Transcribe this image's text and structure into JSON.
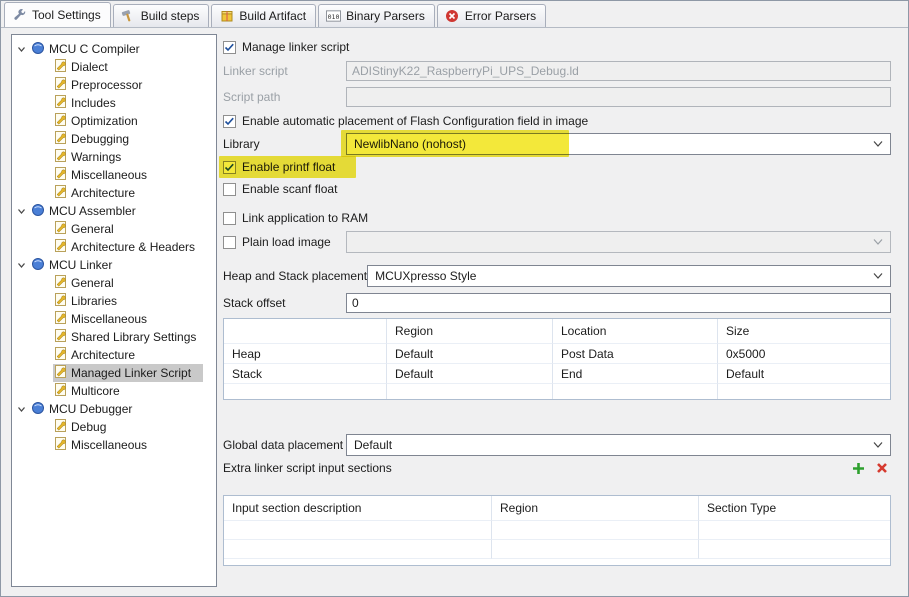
{
  "colors": {
    "highlight": "#f3e83a",
    "selection": "#c9c9c9"
  },
  "tabs": [
    {
      "label": "Tool Settings",
      "icon": "wrench-icon",
      "active": true
    },
    {
      "label": "Build steps",
      "icon": "hammer-icon",
      "active": false
    },
    {
      "label": "Build Artifact",
      "icon": "package-icon",
      "active": false
    },
    {
      "label": "Binary Parsers",
      "icon": "binary-icon",
      "icon_glyph": "010",
      "active": false
    },
    {
      "label": "Error Parsers",
      "icon": "error-icon",
      "active": false
    }
  ],
  "tree": {
    "groups": [
      {
        "label": "MCU C Compiler",
        "children": [
          "Dialect",
          "Preprocessor",
          "Includes",
          "Optimization",
          "Debugging",
          "Warnings",
          "Miscellaneous",
          "Architecture"
        ]
      },
      {
        "label": "MCU Assembler",
        "children": [
          "General",
          "Architecture & Headers"
        ]
      },
      {
        "label": "MCU Linker",
        "children": [
          "General",
          "Libraries",
          "Miscellaneous",
          "Shared Library Settings",
          "Architecture",
          "Managed Linker Script",
          "Multicore"
        ],
        "selected_child": "Managed Linker Script"
      },
      {
        "label": "MCU Debugger",
        "children": [
          "Debug",
          "Miscellaneous"
        ]
      }
    ]
  },
  "form": {
    "manage_linker_script": {
      "label": "Manage linker script",
      "checked": true
    },
    "linker_script": {
      "label": "Linker script",
      "value": "ADIStinyK22_RaspberryPi_UPS_Debug.ld",
      "disabled": true
    },
    "script_path": {
      "label": "Script path",
      "value": "",
      "disabled": true
    },
    "flash_config": {
      "label": "Enable automatic placement of Flash Configuration field in image",
      "checked": true
    },
    "library": {
      "label": "Library",
      "value": "NewlibNano (nohost)"
    },
    "printf_float": {
      "label": "Enable printf float",
      "checked": true
    },
    "scanf_float": {
      "label": "Enable scanf float",
      "checked": false
    },
    "link_to_ram": {
      "label": "Link application to RAM",
      "checked": false
    },
    "plain_load_image": {
      "label": "Plain load image",
      "checked": false,
      "value": ""
    },
    "heap_stack_placement": {
      "label": "Heap and Stack placement",
      "value": "MCUXpresso Style"
    },
    "stack_offset": {
      "label": "Stack offset",
      "value": "0"
    },
    "heap_stack_table": {
      "headers": [
        "",
        "Region",
        "Location",
        "Size"
      ],
      "rows": [
        [
          "Heap",
          "Default",
          "Post Data",
          "0x5000"
        ],
        [
          "Stack",
          "Default",
          "End",
          "Default"
        ]
      ]
    },
    "global_data_placement": {
      "label": "Global data placement",
      "value": "Default"
    },
    "extra_sections": {
      "label": "Extra linker script input sections",
      "headers": [
        "Input section description",
        "Region",
        "Section Type"
      ],
      "rows": []
    }
  }
}
